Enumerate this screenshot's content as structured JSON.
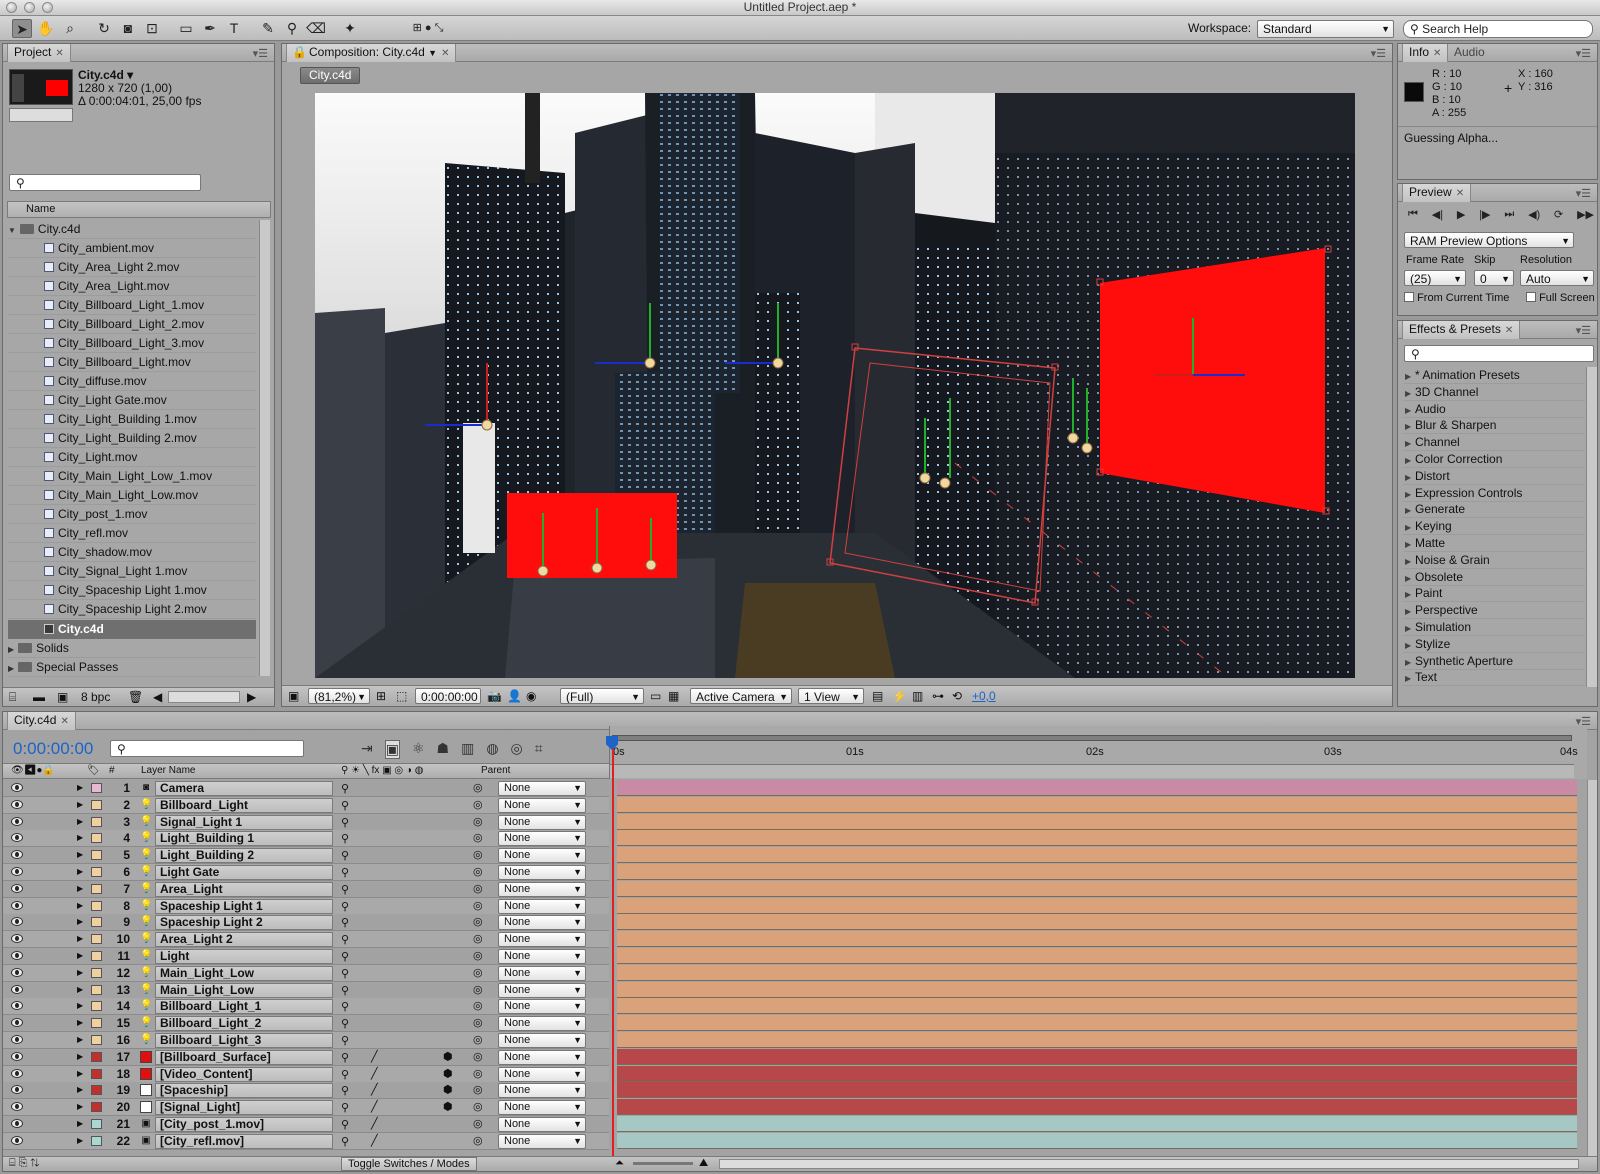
{
  "window": {
    "title": "Untitled Project.aep *"
  },
  "toolbar": {
    "workspace_label": "Workspace:",
    "workspace_value": "Standard",
    "search_placeholder": "Search Help"
  },
  "project": {
    "tab": "Project",
    "comp_name": "City.c4d ▾",
    "comp_size": "1280 x 720 (1,00)",
    "comp_duration": "Δ 0:00:04:01, 25,00 fps",
    "column_name": "Name",
    "root_folder": "City.c4d",
    "files": [
      "City_ambient.mov",
      "City_Area_Light 2.mov",
      "City_Area_Light.mov",
      "City_Billboard_Light_1.mov",
      "City_Billboard_Light_2.mov",
      "City_Billboard_Light_3.mov",
      "City_Billboard_Light.mov",
      "City_diffuse.mov",
      "City_Light Gate.mov",
      "City_Light_Building 1.mov",
      "City_Light_Building 2.mov",
      "City_Light.mov",
      "City_Main_Light_Low_1.mov",
      "City_Main_Light_Low.mov",
      "City_post_1.mov",
      "City_refl.mov",
      "City_shadow.mov",
      "City_Signal_Light 1.mov",
      "City_Spaceship Light 1.mov",
      "City_Spaceship Light 2.mov"
    ],
    "selected_comp": "City.c4d",
    "folders": [
      "Solids",
      "Special Passes"
    ],
    "bpc": "8 bpc"
  },
  "composition": {
    "tab": "Composition: City.c4d",
    "breadcrumb": "City.c4d",
    "zoom": "(81,2%)",
    "timecode": "0:00:00:00",
    "resolution": "(Full)",
    "camera": "Active Camera",
    "views": "1 View",
    "exposure": "+0,0"
  },
  "info": {
    "tab_info": "Info",
    "tab_audio": "Audio",
    "r": "R : 10",
    "g": "G : 10",
    "b": "B : 10",
    "a": "A : 255",
    "x": "X : 160",
    "y": "Y : 316",
    "status": "Guessing Alpha..."
  },
  "preview": {
    "tab": "Preview",
    "options": "RAM Preview Options",
    "frame_rate_label": "Frame Rate",
    "skip_label": "Skip",
    "resolution_label": "Resolution",
    "frame_rate": "(25)",
    "skip": "0",
    "resolution": "Auto",
    "from_current": "From Current Time",
    "full_screen": "Full Screen"
  },
  "effects": {
    "tab": "Effects & Presets",
    "items": [
      "* Animation Presets",
      "3D Channel",
      "Audio",
      "Blur & Sharpen",
      "Channel",
      "Color Correction",
      "Distort",
      "Expression Controls",
      "Generate",
      "Keying",
      "Matte",
      "Noise & Grain",
      "Obsolete",
      "Paint",
      "Perspective",
      "Simulation",
      "Stylize",
      "Synthetic Aperture",
      "Text"
    ]
  },
  "timeline": {
    "tab": "City.c4d",
    "timecode": "0:00:00:00",
    "col_num": "#",
    "col_layer": "Layer Name",
    "col_parent": "Parent",
    "ruler": [
      "0s",
      "01s",
      "02s",
      "03s",
      "04s"
    ],
    "toggle": "Toggle Switches / Modes",
    "layers": [
      {
        "n": "1",
        "name": "Camera",
        "type": "camera",
        "color": "#e8b8d0",
        "bar": "#c98aa6"
      },
      {
        "n": "2",
        "name": "Billboard_Light",
        "type": "light",
        "color": "#f0cfa0",
        "bar": "#d9a27b"
      },
      {
        "n": "3",
        "name": "Signal_Light 1",
        "type": "light",
        "color": "#f0cfa0",
        "bar": "#d9a27b"
      },
      {
        "n": "4",
        "name": "Light_Building 1",
        "type": "light",
        "color": "#f0cfa0",
        "bar": "#d9a27b"
      },
      {
        "n": "5",
        "name": "Light_Building 2",
        "type": "light",
        "color": "#f0cfa0",
        "bar": "#d9a27b"
      },
      {
        "n": "6",
        "name": "Light Gate",
        "type": "light",
        "color": "#f0cfa0",
        "bar": "#d9a27b"
      },
      {
        "n": "7",
        "name": "Area_Light",
        "type": "light",
        "color": "#f0cfa0",
        "bar": "#d9a27b"
      },
      {
        "n": "8",
        "name": "Spaceship Light 1",
        "type": "light",
        "color": "#f0cfa0",
        "bar": "#d9a27b"
      },
      {
        "n": "9",
        "name": "Spaceship Light 2",
        "type": "light",
        "color": "#f0cfa0",
        "bar": "#d9a27b"
      },
      {
        "n": "10",
        "name": "Area_Light 2",
        "type": "light",
        "color": "#f0cfa0",
        "bar": "#d9a27b"
      },
      {
        "n": "11",
        "name": "Light",
        "type": "light",
        "color": "#f0cfa0",
        "bar": "#d9a27b"
      },
      {
        "n": "12",
        "name": "Main_Light_Low",
        "type": "light",
        "color": "#f0cfa0",
        "bar": "#d9a27b"
      },
      {
        "n": "13",
        "name": "Main_Light_Low",
        "type": "light",
        "color": "#f0cfa0",
        "bar": "#d9a27b"
      },
      {
        "n": "14",
        "name": "Billboard_Light_1",
        "type": "light",
        "color": "#f0cfa0",
        "bar": "#d9a27b"
      },
      {
        "n": "15",
        "name": "Billboard_Light_2",
        "type": "light",
        "color": "#f0cfa0",
        "bar": "#d9a27b"
      },
      {
        "n": "16",
        "name": "Billboard_Light_3",
        "type": "light",
        "color": "#f0cfa0",
        "bar": "#d9a27b"
      },
      {
        "n": "17",
        "name": "[Billboard_Surface]",
        "type": "solid-red",
        "color": "#c0302c",
        "bar": "#b6484a"
      },
      {
        "n": "18",
        "name": "[Video_Content]",
        "type": "solid-red",
        "color": "#c0302c",
        "bar": "#b6484a"
      },
      {
        "n": "19",
        "name": "[Spaceship]",
        "type": "solid-white",
        "color": "#c0302c",
        "bar": "#b6484a"
      },
      {
        "n": "20",
        "name": "[Signal_Light]",
        "type": "solid-white",
        "color": "#c0302c",
        "bar": "#b6484a"
      },
      {
        "n": "21",
        "name": "[City_post_1.mov]",
        "type": "footage",
        "color": "#a8d8d0",
        "bar": "#a6c8c4"
      },
      {
        "n": "22",
        "name": "[City_refl.mov]",
        "type": "footage",
        "color": "#a8d8d0",
        "bar": "#a6c8c4"
      }
    ],
    "parent_value": "None"
  },
  "colors": {
    "accent": "#1d63c8",
    "billboard_red": "#ff0c0c",
    "timeline_orange": "#d9a27b"
  }
}
